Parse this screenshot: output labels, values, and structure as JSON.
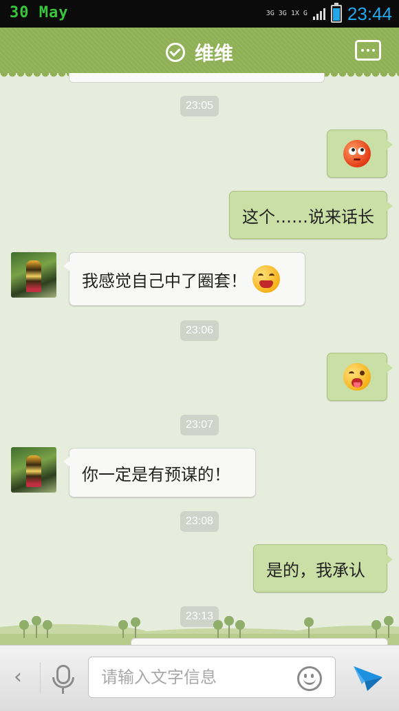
{
  "status_bar": {
    "date": "30 May",
    "network": "3G 3G 1X G",
    "time": "23:44",
    "battery_level": 0.8
  },
  "header": {
    "contact_name": "维维"
  },
  "messages": [
    {
      "type": "time",
      "text": "23:05"
    },
    {
      "type": "out",
      "emoji": "flushed-face"
    },
    {
      "type": "out",
      "text": "这个……说来话长"
    },
    {
      "type": "in",
      "text": "我感觉自己中了圈套！",
      "emoji": "grimace-face"
    },
    {
      "type": "time",
      "text": "23:06"
    },
    {
      "type": "out",
      "emoji": "wink-tongue-face"
    },
    {
      "type": "time",
      "text": "23:07"
    },
    {
      "type": "in",
      "text": "你一定是有预谋的！"
    },
    {
      "type": "time",
      "text": "23:08"
    },
    {
      "type": "out",
      "text": "是的，我承认"
    },
    {
      "type": "time",
      "text": "23:13"
    }
  ],
  "input_bar": {
    "back_symbol": "‹",
    "placeholder": "请输入文字信息",
    "value": ""
  },
  "colors": {
    "header_green": "#8fb055",
    "outgoing_bubble": "#c9dfa6",
    "incoming_bubble": "#f8f8f6",
    "chat_background": "#e6eddc",
    "status_time_blue": "#21a9f0",
    "status_date_green": "#38c73a",
    "send_arrow_blue": "#1e90e0"
  },
  "icons": [
    "check-circle-icon",
    "more-menu-icon",
    "mic-icon",
    "smiley-icon",
    "send-arrow-icon",
    "back-chevron-icon"
  ]
}
